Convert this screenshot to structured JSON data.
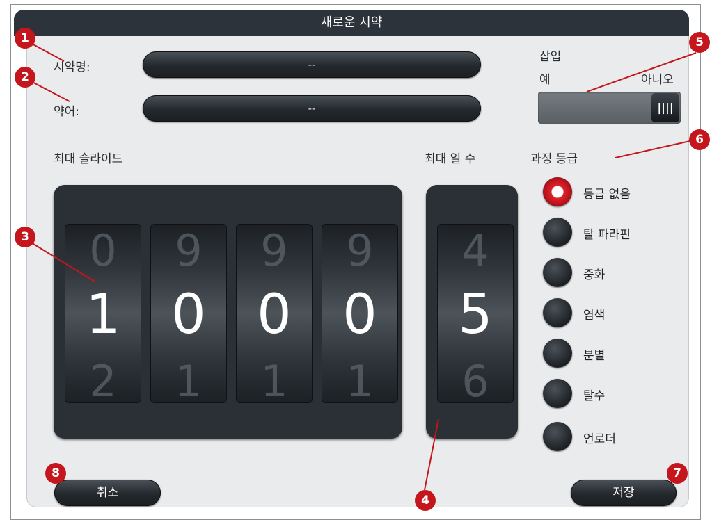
{
  "dialog": {
    "title": "새로운 시약"
  },
  "reagent_name": {
    "label": "시약명:",
    "value": "--"
  },
  "abbreviation": {
    "label": "약어:",
    "value": "--"
  },
  "insert": {
    "label": "삽입",
    "yes": "예",
    "no": "아니오",
    "knob": "||||",
    "state": "아니오"
  },
  "max_slides": {
    "label": "최대 슬라이드",
    "digits": [
      {
        "prev": "0",
        "cur": "1",
        "next": "2"
      },
      {
        "prev": "9",
        "cur": "0",
        "next": "1"
      },
      {
        "prev": "9",
        "cur": "0",
        "next": "1"
      },
      {
        "prev": "9",
        "cur": "0",
        "next": "1"
      }
    ]
  },
  "max_days": {
    "label": "최대 일 수",
    "prev": "4",
    "cur": "5",
    "next": "6"
  },
  "process_class": {
    "label": "과정 등급",
    "selected": "등급 없음",
    "options": [
      "등급 없음",
      "탈 파라핀",
      "중화",
      "염색",
      "분별",
      "탈수",
      "언로더"
    ]
  },
  "buttons": {
    "cancel": "취소",
    "save": "저장"
  },
  "callouts": [
    "1",
    "2",
    "3",
    "4",
    "5",
    "6",
    "7",
    "8"
  ],
  "colors": {
    "callout": "#c4161c",
    "titlebar": "#2d333a",
    "panel": "#e9ebec"
  }
}
